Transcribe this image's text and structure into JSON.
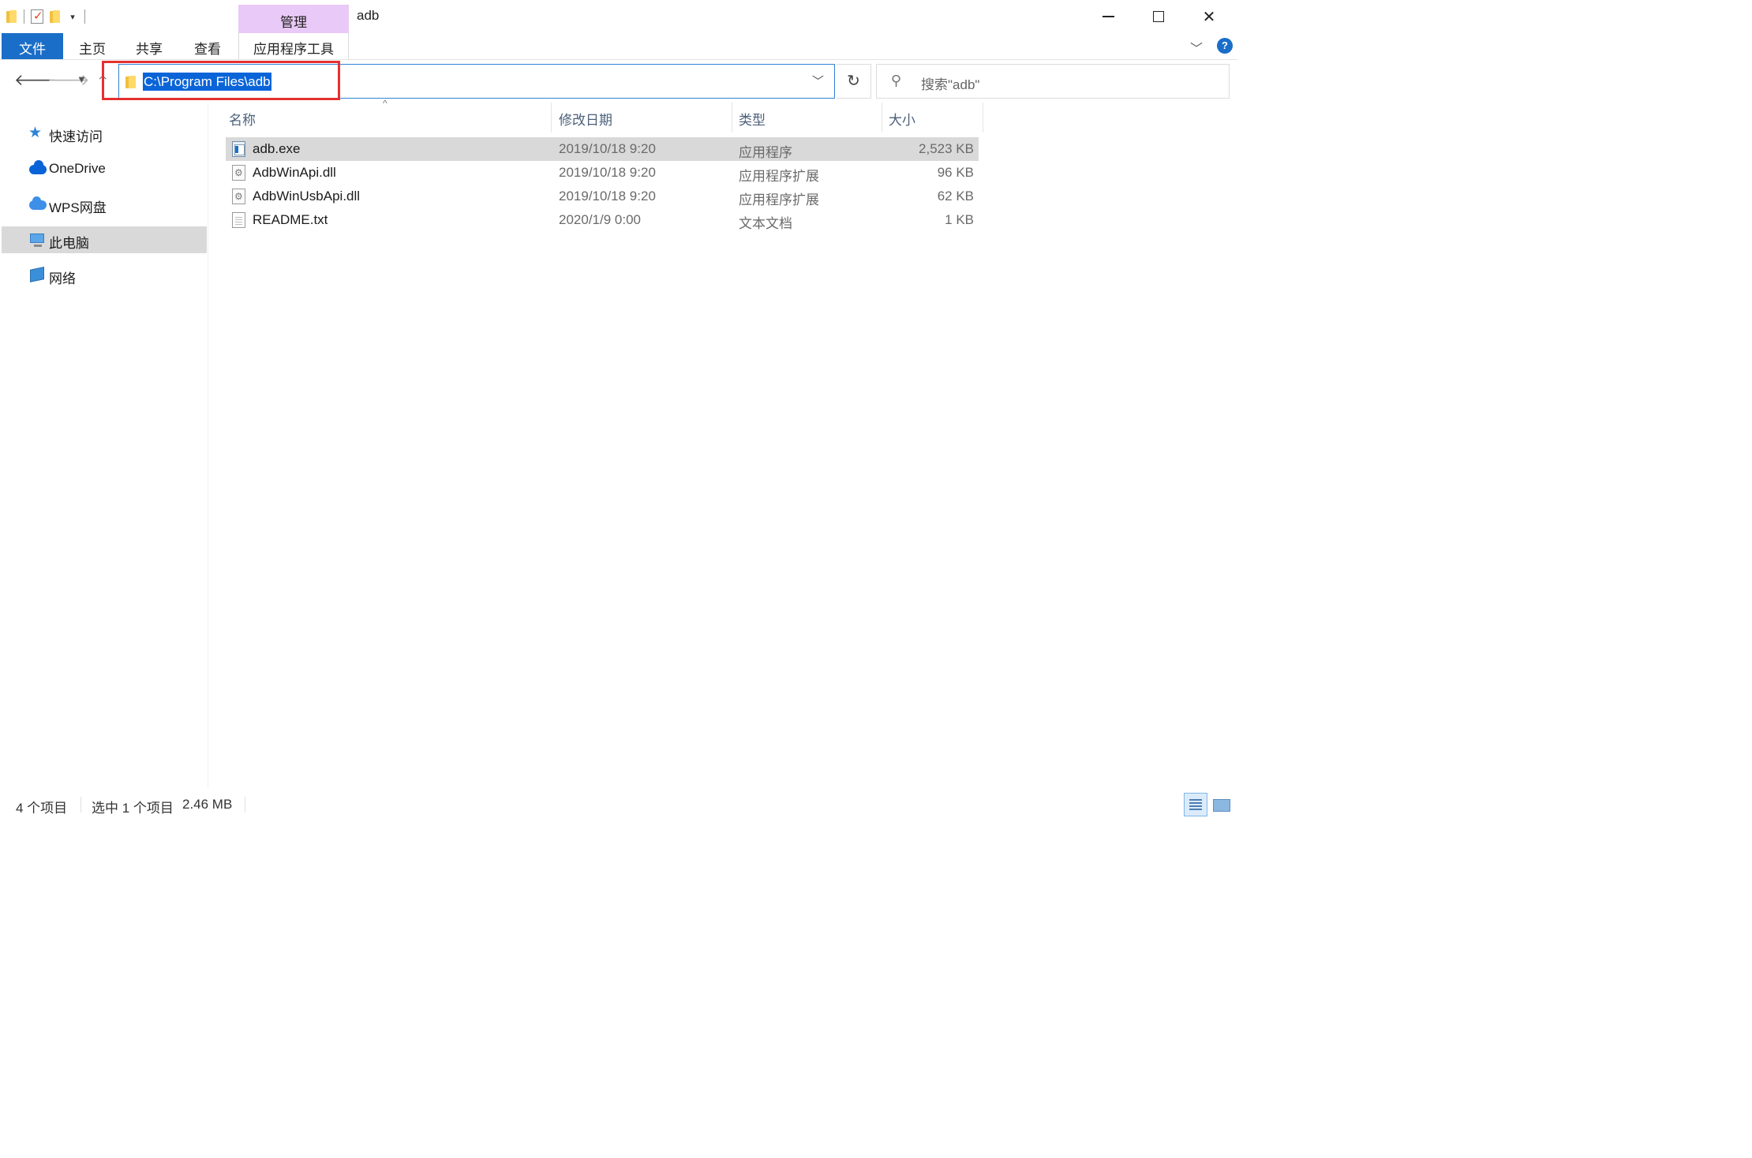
{
  "window": {
    "title": "adb",
    "context_tab": "管理",
    "controls": {
      "minimize": "minimize",
      "maximize": "maximize",
      "close": "✕"
    }
  },
  "ribbon": {
    "tabs": [
      "文件",
      "主页",
      "共享",
      "查看",
      "应用程序工具"
    ],
    "help": "?"
  },
  "address": {
    "path": "C:\\Program Files\\adb",
    "search_placeholder": "搜索\"adb\""
  },
  "sidebar": {
    "items": [
      {
        "label": "快速访问",
        "icon": "star-icon",
        "selected": false
      },
      {
        "label": "OneDrive",
        "icon": "onedrive-cloud-icon",
        "selected": false
      },
      {
        "label": "WPS网盘",
        "icon": "wps-cloud-icon",
        "selected": false
      },
      {
        "label": "此电脑",
        "icon": "computer-icon",
        "selected": true
      },
      {
        "label": "网络",
        "icon": "network-icon",
        "selected": false
      }
    ]
  },
  "columns": {
    "name": "名称",
    "date": "修改日期",
    "type": "类型",
    "size": "大小"
  },
  "files": [
    {
      "name": "adb.exe",
      "date": "2019/10/18 9:20",
      "type": "应用程序",
      "size": "2,523 KB",
      "icon": "exe-icon",
      "selected": true
    },
    {
      "name": "AdbWinApi.dll",
      "date": "2019/10/18 9:20",
      "type": "应用程序扩展",
      "size": "96 KB",
      "icon": "dll-icon",
      "selected": false
    },
    {
      "name": "AdbWinUsbApi.dll",
      "date": "2019/10/18 9:20",
      "type": "应用程序扩展",
      "size": "62 KB",
      "icon": "dll-icon",
      "selected": false
    },
    {
      "name": "README.txt",
      "date": "2020/1/9 0:00",
      "type": "文本文档",
      "size": "1 KB",
      "icon": "txt-icon",
      "selected": false
    }
  ],
  "status": {
    "count": "4 个项目",
    "selection": "选中 1 个项目",
    "selection_size": "2.46 MB"
  },
  "colors": {
    "accent": "#1a6ec8",
    "context_tab": "#e9c9f7",
    "selection": "#d9d9d9",
    "highlight_box": "#e5312f"
  }
}
